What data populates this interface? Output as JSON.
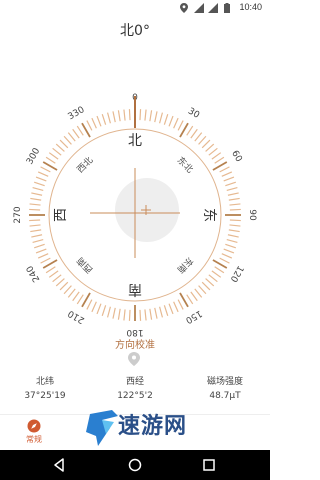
{
  "status_bar": {
    "time": "10:40"
  },
  "heading": {
    "text": "北0°"
  },
  "compass": {
    "degree_labels": [
      "0",
      "30",
      "60",
      "90",
      "120",
      "150",
      "180",
      "210",
      "240",
      "270",
      "300",
      "330"
    ],
    "cardinals": {
      "n": "北",
      "e": "东",
      "s": "南",
      "w": "西"
    },
    "intercardinals": {
      "ne": "东北",
      "se": "东南",
      "sw": "西南",
      "nw": "西北"
    },
    "heading_degrees": 0,
    "accent_color": "#c98c5a"
  },
  "calibration": {
    "label": "方向校准"
  },
  "info": [
    {
      "label": "北纬",
      "value": "37°25'19"
    },
    {
      "label": "西经",
      "value": "122°5'2"
    },
    {
      "label": "磁场强度",
      "value": "48.7μT"
    }
  ],
  "tabs": [
    {
      "label": "常规",
      "active": true
    }
  ],
  "watermark": {
    "text": "速游网"
  }
}
